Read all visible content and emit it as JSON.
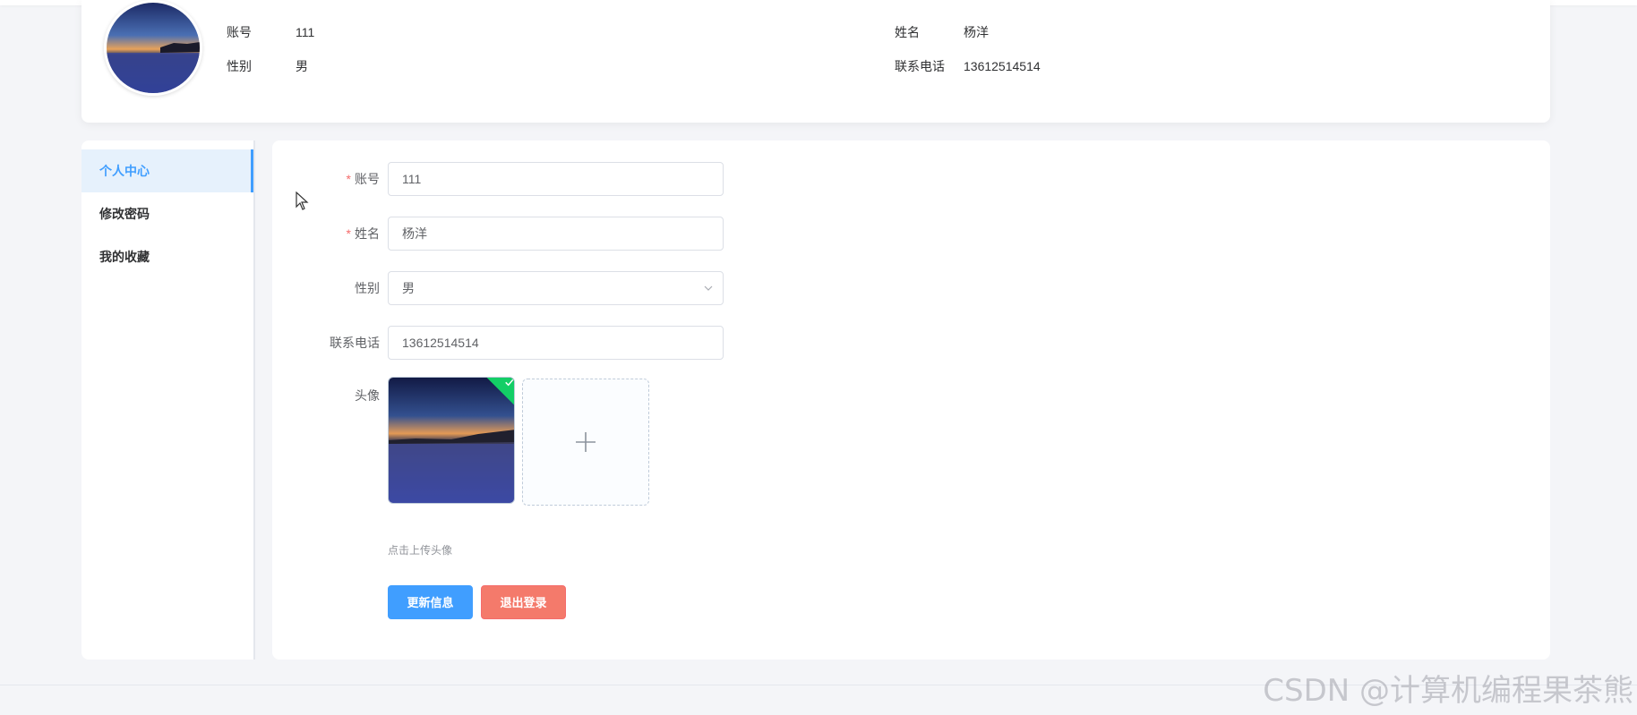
{
  "profile": {
    "account_label": "账号",
    "account_value": "111",
    "name_label": "姓名",
    "name_value": "杨洋",
    "gender_label": "性别",
    "gender_value": "男",
    "phone_label": "联系电话",
    "phone_value": "13612514514"
  },
  "menu": {
    "items": [
      {
        "label": "个人中心",
        "active": true
      },
      {
        "label": "修改密码",
        "active": false
      },
      {
        "label": "我的收藏",
        "active": false
      }
    ]
  },
  "form": {
    "account": {
      "label": "账号",
      "value": "111",
      "required": "*"
    },
    "name": {
      "label": "姓名",
      "value": "杨洋",
      "required": "*"
    },
    "gender": {
      "label": "性别",
      "value": "男"
    },
    "phone": {
      "label": "联系电话",
      "value": "13612514514"
    },
    "avatar": {
      "label": "头像",
      "tip": "点击上传头像"
    },
    "update_button": "更新信息",
    "logout_button": "退出登录"
  },
  "watermark": "CSDN @计算机编程果茶熊",
  "colors": {
    "primary": "#409eff",
    "danger": "#f47a6b",
    "success": "#13ce66",
    "required": "#f56c6c"
  }
}
